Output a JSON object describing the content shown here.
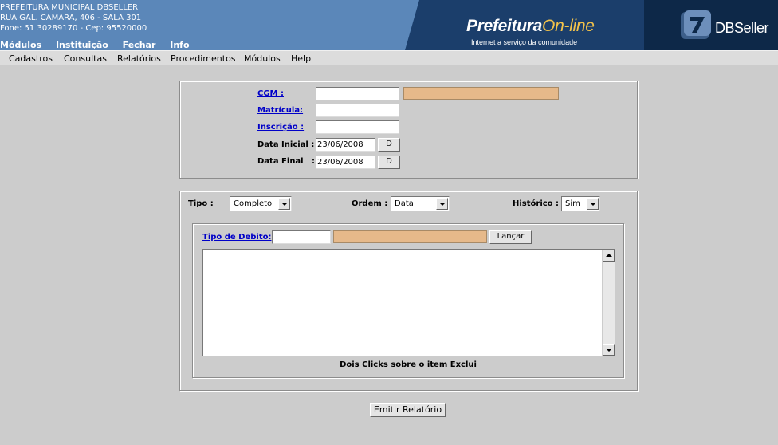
{
  "header": {
    "org_name": "PREFEITURA MUNICIPAL DBSELLER",
    "address": "RUA GAL. CAMARA, 406 - SALA 301",
    "phone_line": "Fone: 51 30289170  -  Cep: 95520000",
    "top_menu": [
      "Módulos",
      "Instituição",
      "Fechar",
      "Info"
    ],
    "brand_main": "Prefeitura",
    "brand_online": "On-line",
    "brand_tagline": "Internet a serviço da comunidade",
    "dbseller_logo": "DBSeller"
  },
  "menu": {
    "items": [
      "Cadastros",
      "Consultas",
      "Relatórios",
      "Procedimentos",
      "Módulos",
      "Help"
    ]
  },
  "filters": {
    "cgm_label": "CGM :",
    "cgm_value": "",
    "matricula_label": "Matrícula:",
    "matricula_value": "",
    "inscricao_label": "Inscrição :",
    "inscricao_value": "",
    "data_inicial_label": "Data Inicial :",
    "data_inicial_value": "23/06/2008",
    "data_final_label": "Data Final   :",
    "data_final_value": "23/06/2008",
    "date_button_label": "D"
  },
  "options": {
    "tipo_label": "Tipo :",
    "tipo_value": "Completo",
    "ordem_label": "Ordem :",
    "ordem_value": "Data",
    "historico_label": "Histórico :",
    "historico_value": "Sim",
    "tipo_debito_label": "Tipo de Debito:",
    "tipo_debito_value": "",
    "lancar_label": "Lançar",
    "list_hint": "Dois Clicks sobre o item Exclui",
    "list_items": []
  },
  "actions": {
    "emit_label": "Emitir Relatório"
  },
  "colors": {
    "header_bg": "#5b87b9",
    "banner_bg": "#1b3e6b",
    "readonly_field": "#e6b98a",
    "link": "#0000c8"
  }
}
